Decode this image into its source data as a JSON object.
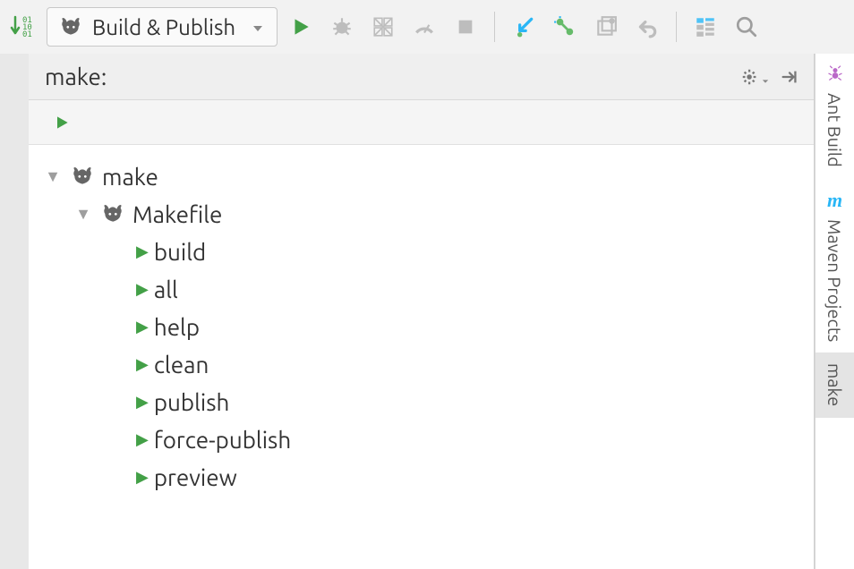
{
  "toolbar": {
    "run_config_label": "Build & Publish"
  },
  "panel": {
    "title": "make:"
  },
  "tree": {
    "root": {
      "label": "make"
    },
    "makefile": {
      "label": "Makefile"
    },
    "targets": [
      "build",
      "all",
      "help",
      "clean",
      "publish",
      "force-publish",
      "preview"
    ]
  },
  "right_tabs": {
    "ant": "Ant Build",
    "maven": "Maven Projects",
    "make": "make"
  }
}
